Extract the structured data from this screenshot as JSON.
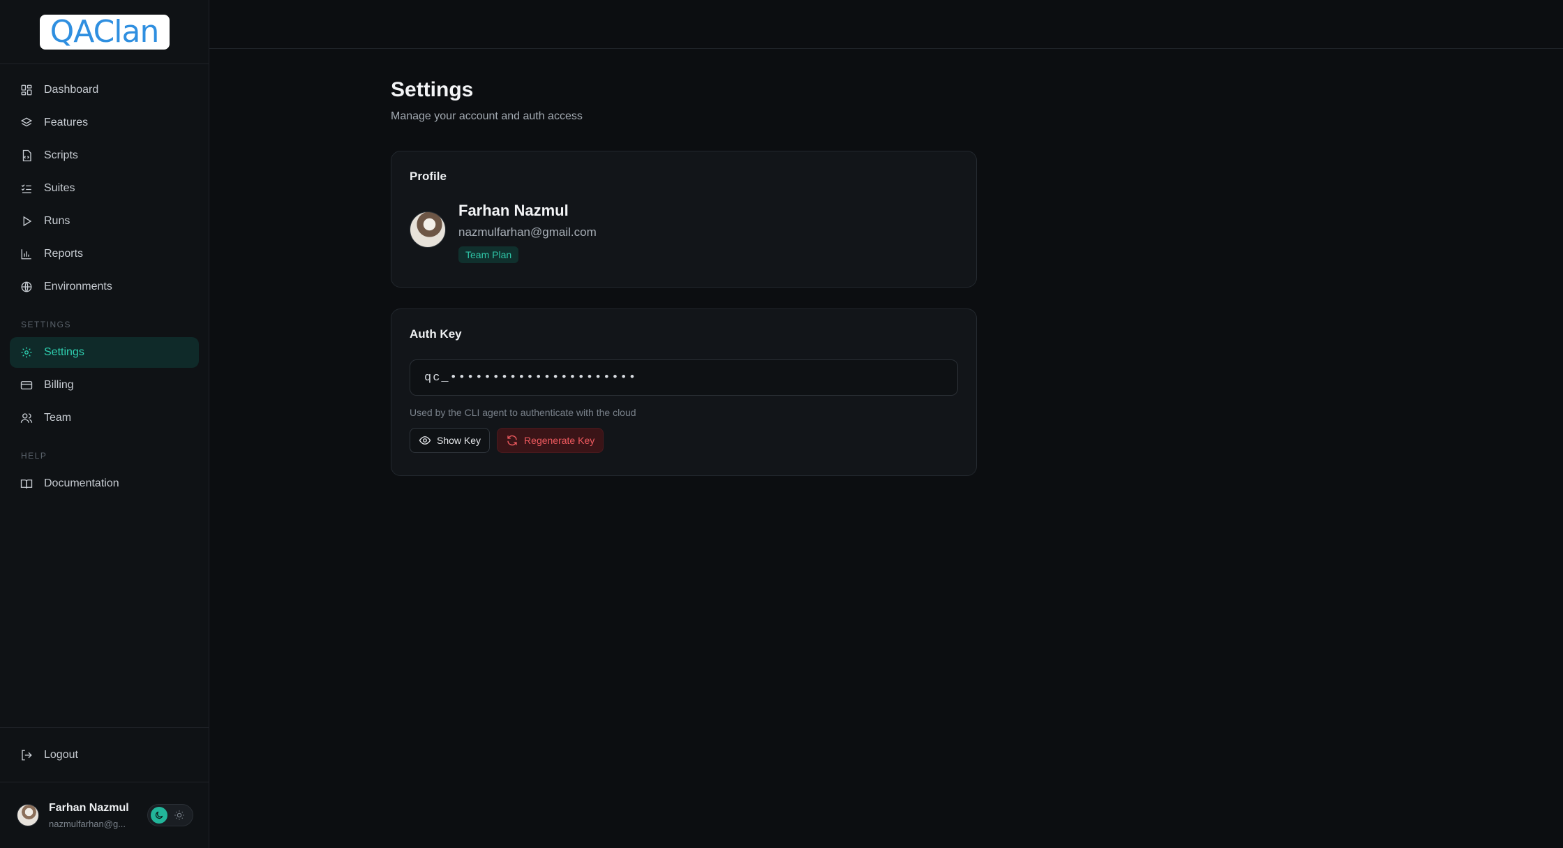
{
  "app": {
    "logo_text": "QAClan"
  },
  "sidebar": {
    "nav": [
      {
        "label": "Dashboard",
        "icon": "grid-icon"
      },
      {
        "label": "Features",
        "icon": "layers-icon"
      },
      {
        "label": "Scripts",
        "icon": "file-code-icon"
      },
      {
        "label": "Suites",
        "icon": "list-checks-icon"
      },
      {
        "label": "Runs",
        "icon": "play-icon"
      },
      {
        "label": "Reports",
        "icon": "bar-chart-icon"
      },
      {
        "label": "Environments",
        "icon": "globe-icon"
      }
    ],
    "settings_section_label": "SETTINGS",
    "settings_items": [
      {
        "label": "Settings",
        "icon": "gear-icon",
        "active": true
      },
      {
        "label": "Billing",
        "icon": "credit-card-icon"
      },
      {
        "label": "Team",
        "icon": "users-icon"
      }
    ],
    "help_section_label": "HELP",
    "help_items": [
      {
        "label": "Documentation",
        "icon": "book-icon"
      }
    ],
    "logout_label": "Logout",
    "user": {
      "name": "Farhan Nazmul",
      "email": "nazmulfarhan@g..."
    }
  },
  "page": {
    "title": "Settings",
    "subtitle": "Manage your account and auth access"
  },
  "profile": {
    "title": "Profile",
    "name": "Farhan Nazmul",
    "email": "nazmulfarhan@gmail.com",
    "plan": "Team Plan"
  },
  "auth": {
    "title": "Auth Key",
    "key_masked": "qc_••••••••••••••••••••••",
    "help": "Used by the CLI agent to authenticate with the cloud",
    "show_key_label": "Show Key",
    "regenerate_label": "Regenerate Key"
  },
  "colors": {
    "accent": "#2fd1b1",
    "danger": "#f05a5f",
    "background": "#0c0e11",
    "sidebar": "#0f1215"
  }
}
